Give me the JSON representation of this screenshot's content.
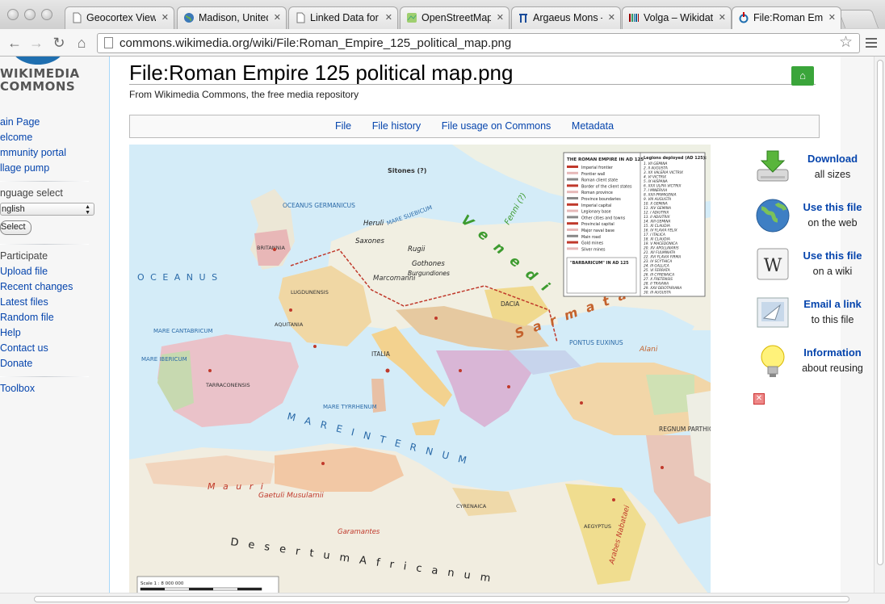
{
  "browser": {
    "tabs": [
      {
        "title": "Geocortex View",
        "icon": "document-icon",
        "active": false
      },
      {
        "title": "Madison, United",
        "icon": "globe-icon",
        "active": false
      },
      {
        "title": "Linked Data for",
        "icon": "document-icon",
        "active": false
      },
      {
        "title": "OpenStreetMap",
        "icon": "osm-icon",
        "active": false
      },
      {
        "title": "Argaeus Mons –",
        "icon": "pi-icon",
        "active": false
      },
      {
        "title": "Volga – Wikidat",
        "icon": "wikidata-icon",
        "active": false
      },
      {
        "title": "File:Roman Emp",
        "icon": "commons-icon",
        "active": true
      }
    ],
    "url": "commons.wikimedia.org/wiki/File:Roman_Empire_125_political_map.png"
  },
  "site": {
    "logo_line1": "WIKIMEDIA",
    "logo_line2": "COMMONS"
  },
  "sidebar": {
    "nav": [
      "ain Page",
      "elcome",
      "mmunity portal",
      "llage pump"
    ],
    "language_heading": "nguage select",
    "language_value": "nglish",
    "select_button": "Select",
    "participate_heading": "Participate",
    "participate": [
      "Upload file",
      "Recent changes",
      "Latest files",
      "Random file",
      "Help",
      "Contact us",
      "Donate"
    ],
    "toolbox": "Toolbox"
  },
  "page": {
    "title": "File:Roman Empire 125 political map.png",
    "tagline": "From Wikimedia Commons, the free media repository",
    "file_nav": [
      "File",
      "File history",
      "File usage on Commons",
      "Metadata"
    ]
  },
  "map": {
    "labels": {
      "oceanus_w": "O C E A N U S",
      "oceanus_germanicus": "OCEANUS GERMANICUS",
      "mare_suebicum": "MARE SUEBICUM",
      "venedi": "V e n e d i",
      "fenni": "Fenni (?)",
      "sitones": "Sitones (?)",
      "sarmatae": "S a r m a t a e",
      "mare_internum": "M A R E   I N T E R N U M",
      "mauri": "M a u r i",
      "gaetuli": "Gaetuli Musulamii",
      "garamantes": "Garamantes",
      "desertum": "D e s e r t u m   A f r i c a n u m",
      "arabes": "Arabes Nabataei",
      "regnum": "REGNUM PARTHICUM",
      "alani": "Alani",
      "marcomanni": "Marcomanni",
      "gothones": "Gothones",
      "burgundiones": "Burgundiones",
      "saxones": "Saxones",
      "rugii": "Rugii",
      "heruli": "Heruli",
      "dacia": "DACIA",
      "italia": "ITALIA",
      "pontus": "PONTUS EUXINUS",
      "cyrenaica": "CYRENAICA",
      "aegyptus": "AEGYPTUS",
      "britannia": "BRITANNIA",
      "hispania": "TARRACONENSIS",
      "lugdunensis": "LUGDUNENSIS",
      "aquitania": "AQUITANIA",
      "mare_ibericum": "MARE IBERICUM",
      "mare_tyrrhenum": "MARE TYRRHENUM",
      "mare_cantabricum": "MARE CANTABRICUM",
      "scale": "Scale 1 : 8 000 000"
    },
    "legend_title": "THE ROMAN EMPIRE IN AD 125",
    "legend_items": [
      "Imperial frontier",
      "Frontier wall",
      "Roman client state",
      "Border of the client states",
      "Roman province",
      "Province boundaries",
      "Imperial capital",
      "Legionary base",
      "Other cities and towns",
      "Provincial capital",
      "Major naval base",
      "Main road",
      "Gold mines",
      "Silver mines"
    ],
    "barbaricum_title": "\"BARBARICUM\" IN AD 125",
    "legions_title": "Legions deployed (AD 125):",
    "legions": [
      "1. VII GEMINA",
      "2. II AUGUSTA",
      "3. XX VALERIA VICTRIX",
      "4. VI VICTRIX",
      "5. IX HISPANA",
      "6. XXX ULPIA VICTRIX",
      "7. I MINERVIA",
      "8. XXII PRIMIGENIA",
      "9. VIII AUGUSTA",
      "10. X GEMINA",
      "11. XIV GEMINA",
      "12. I ADIUTRIX",
      "13. II ADIUTRIX",
      "14. XIII GEMINA",
      "15. XI CLAUDIA",
      "16. IV FLAVIA FELIX",
      "17. I ITALICA",
      "18. XI CLAUDIA",
      "19. V MACEDONICA",
      "20. XV APOLLINARIS",
      "21. XII FULMINATA",
      "22. XVI FLAVIA FIRMA",
      "23. IV SCYTHICA",
      "24. III GALLICA",
      "25. VI FERRATA",
      "26. III CYRENAICA",
      "27. X FRETENSIS",
      "28. II TRAIANA",
      "29. XXII DEIOTARIANA",
      "30. III AUGUSTA"
    ]
  },
  "actions": [
    {
      "title": "Download",
      "subtitle": "all sizes",
      "icon": "download-icon"
    },
    {
      "title": "Use this file",
      "subtitle": "on the web",
      "icon": "globe-icon"
    },
    {
      "title": "Use this file",
      "subtitle": "on a wiki",
      "icon": "wikipedia-icon"
    },
    {
      "title": "Email a link",
      "subtitle": "to this file",
      "icon": "email-icon"
    },
    {
      "title": "Information",
      "subtitle": "about reusing",
      "icon": "lightbulb-icon"
    }
  ]
}
